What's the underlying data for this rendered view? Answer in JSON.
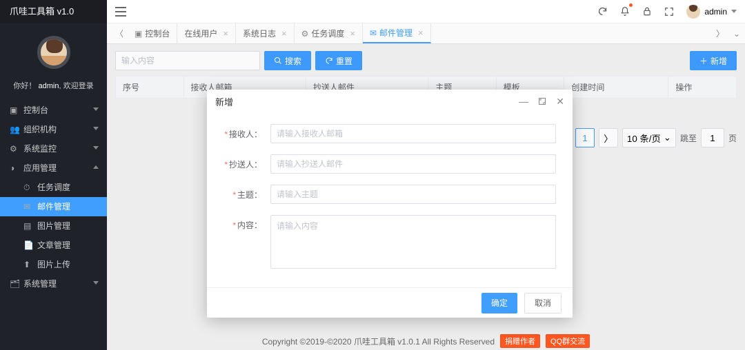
{
  "app": {
    "title": "爪哇工具箱 v1.0"
  },
  "user": {
    "greeting": "你好！",
    "name": "admin",
    "greet_tail": ", 欢迎登录",
    "header_name": "admin"
  },
  "sidebar": {
    "items": [
      {
        "icon": "▣",
        "label": "控制台"
      },
      {
        "icon": "👥",
        "label": "组织机构"
      },
      {
        "icon": "⚙",
        "label": "系统监控"
      },
      {
        "icon": "◑",
        "label": "应用管理",
        "expanded": true
      },
      {
        "icon": "⏱",
        "label": "任务调度",
        "sub": true
      },
      {
        "icon": "✉",
        "label": "邮件管理",
        "sub": true,
        "active": true
      },
      {
        "icon": "▤",
        "label": "图片管理",
        "sub": true
      },
      {
        "icon": "📄",
        "label": "文章管理",
        "sub": true
      },
      {
        "icon": "⬆",
        "label": "图片上传",
        "sub": true
      },
      {
        "icon": "🗂",
        "label": "系统管理"
      }
    ]
  },
  "tabs": {
    "items": [
      {
        "icon": "▣",
        "label": "控制台",
        "closable": false
      },
      {
        "label": "在线用户",
        "closable": true
      },
      {
        "label": "系统日志",
        "closable": true
      },
      {
        "icon": "⚙",
        "label": "任务调度",
        "closable": true
      },
      {
        "icon": "✉",
        "label": "邮件管理",
        "closable": true,
        "selected": true
      }
    ]
  },
  "toolbar": {
    "search_placeholder": "输入内容",
    "search_label": "搜索",
    "reset_label": "重置",
    "add_label": "新增"
  },
  "table": {
    "columns": [
      "序号",
      "接收人邮箱",
      "抄送人邮件",
      "主题",
      "模板",
      "创建时间",
      "操作"
    ]
  },
  "pagination": {
    "page_size_label": "10 条/页",
    "jump_label": "跳至",
    "jump_value": "1",
    "page_unit": "页",
    "current": "1"
  },
  "modal": {
    "title": "新增",
    "fields": [
      {
        "label": "接收人",
        "placeholder": "请输入接收人邮箱",
        "type": "text"
      },
      {
        "label": "抄送人",
        "placeholder": "请输入抄送人邮件",
        "type": "text"
      },
      {
        "label": "主题",
        "placeholder": "请输入主题",
        "type": "text"
      },
      {
        "label": "内容",
        "placeholder": "请输入内容",
        "type": "textarea"
      }
    ],
    "ok": "确定",
    "cancel": "取消"
  },
  "footer": {
    "copyright": "Copyright ©2019-©2020 爪哇工具箱 v1.0.1 All Rights Reserved",
    "tag1": "捐赠作者",
    "tag2": "QQ群交流"
  }
}
